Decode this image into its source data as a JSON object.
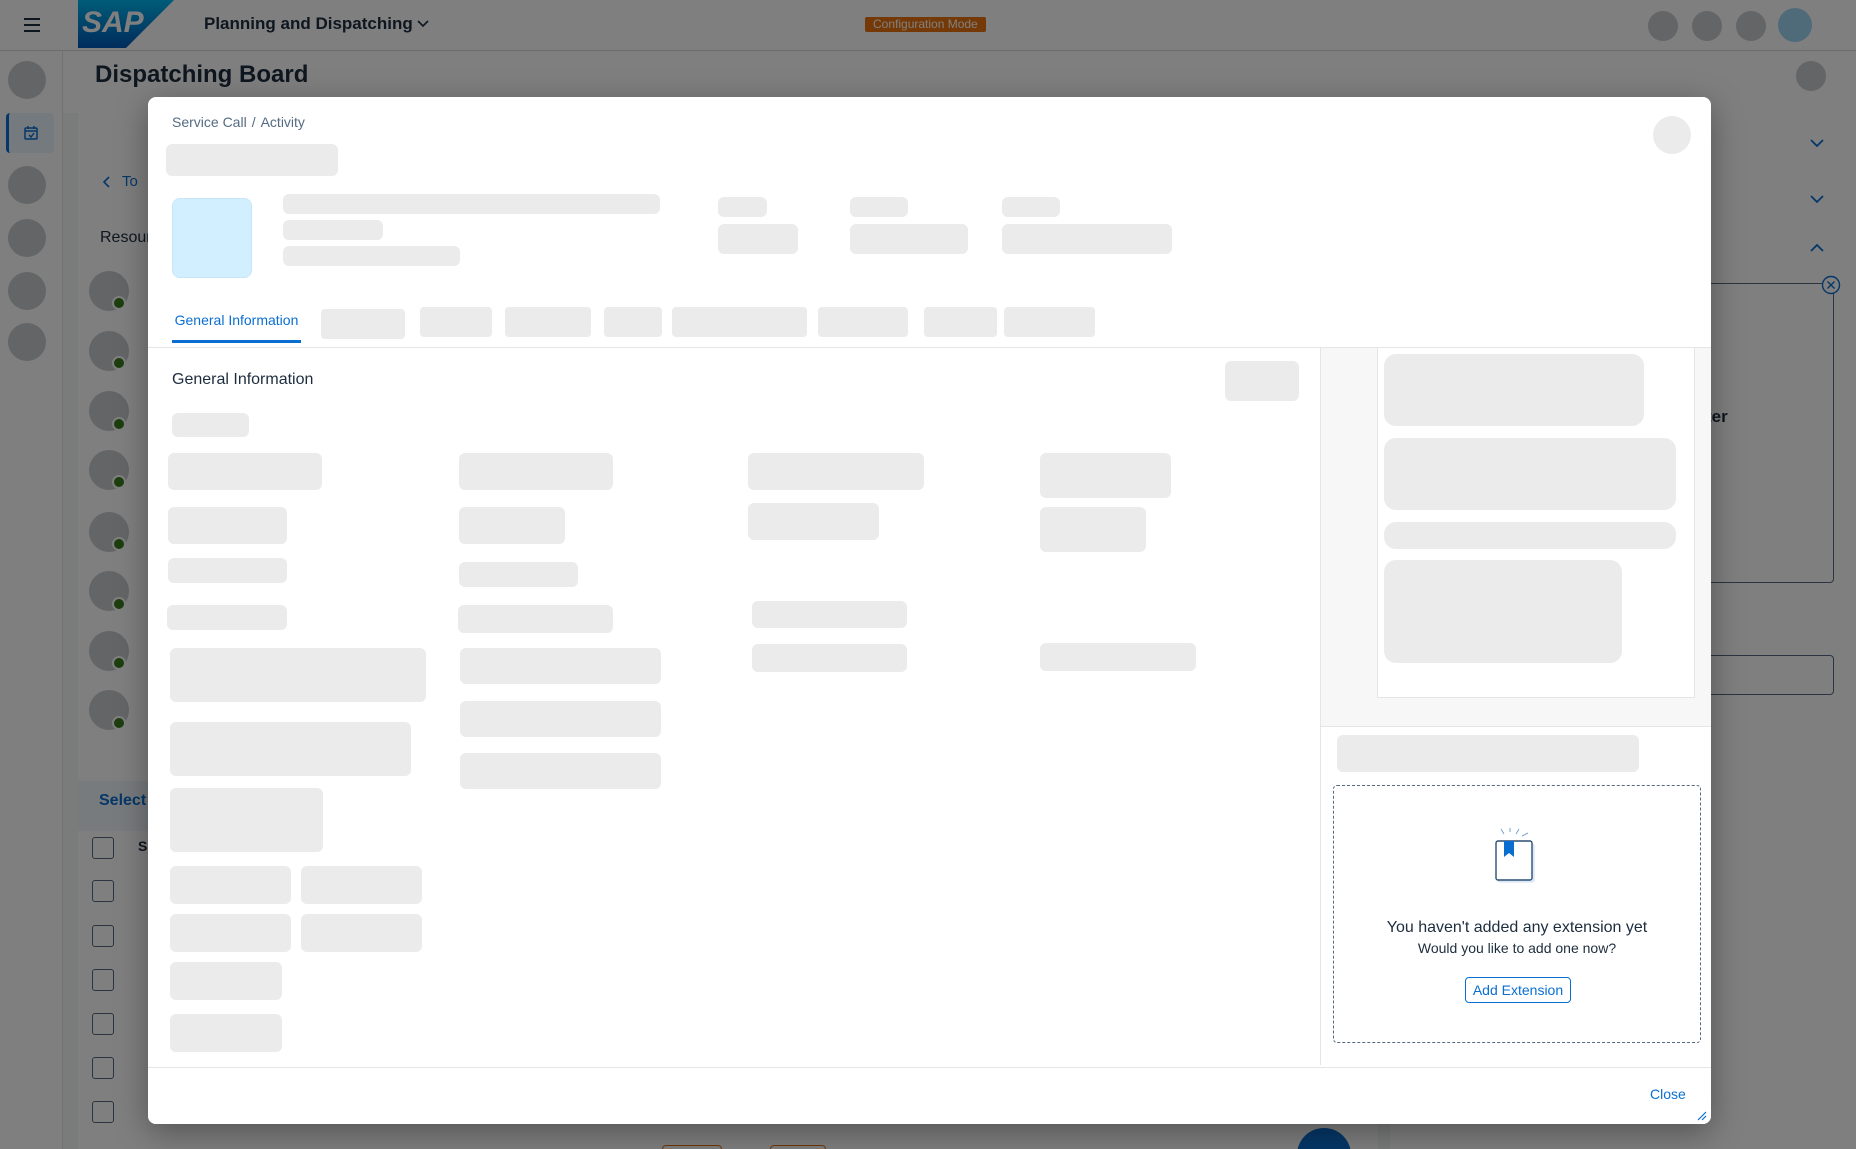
{
  "shell": {
    "app_title": "Planning and Dispatching",
    "mode_badge": "Configuration Mode",
    "logo_text": "SAP"
  },
  "page": {
    "title": "Dispatching Board",
    "partial_texts": {
      "back_link": "To",
      "resources": "Resour",
      "select": "Select",
      "col_header": "S",
      "right_panel_text": "ter"
    }
  },
  "dialog": {
    "breadcrumb_service_call": "Service Call",
    "breadcrumb_separator": "/",
    "breadcrumb_activity": "Activity",
    "active_tab": "General Information",
    "section_title": "General Information",
    "extension": {
      "title": "You haven't added any extension yet",
      "subtitle": "Would you like to add one now?",
      "button": "Add Extension"
    },
    "close_button": "Close"
  },
  "colors": {
    "brand": "#0a6ed1",
    "badge": "#e9730c",
    "status_online": "#3a7d1d",
    "skeleton": "#ebebeb",
    "avatar_placeholder": "#d1efff"
  },
  "icons": [
    "menu-icon",
    "chevron-down-icon",
    "calendar-icon",
    "chevron-left-icon",
    "close-circle-icon",
    "resize-handle-icon",
    "bookmark-document-icon"
  ]
}
